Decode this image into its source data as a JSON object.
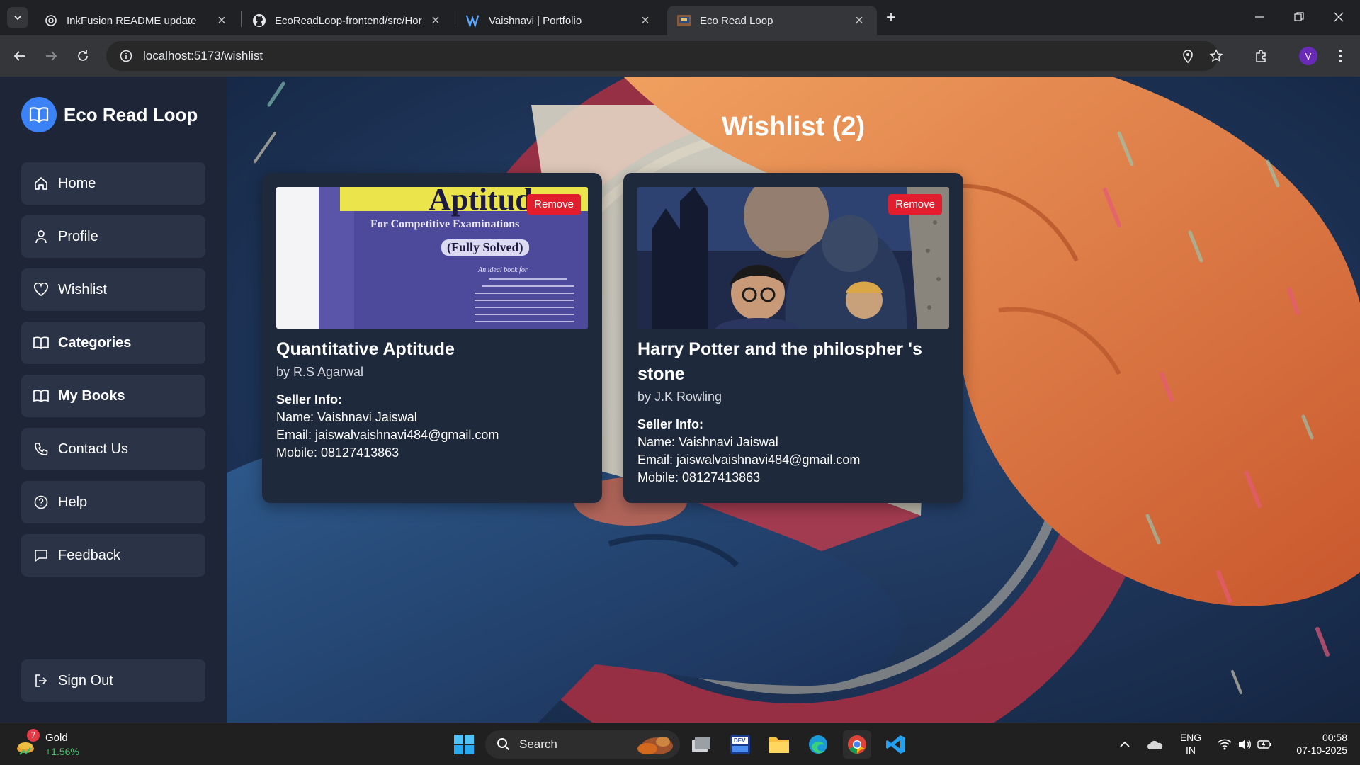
{
  "browser": {
    "tabs": [
      {
        "title": "InkFusion README update",
        "active": false
      },
      {
        "title": "EcoReadLoop-frontend/src/Hor",
        "active": false
      },
      {
        "title": "Vaishnavi | Portfolio",
        "active": false
      },
      {
        "title": "Eco Read Loop",
        "active": true
      }
    ],
    "url": "localhost:5173/wishlist",
    "profile_initial": "V"
  },
  "app": {
    "brand": "Eco Read Loop",
    "nav": [
      {
        "label": "Home",
        "icon": "home-icon"
      },
      {
        "label": "Profile",
        "icon": "user-icon"
      },
      {
        "label": "Wishlist",
        "icon": "heart-icon"
      },
      {
        "label": "Categories",
        "icon": "book-open-icon"
      },
      {
        "label": "My Books",
        "icon": "book-open-icon"
      },
      {
        "label": "Contact Us",
        "icon": "phone-icon"
      },
      {
        "label": "Help",
        "icon": "help-circle-icon"
      },
      {
        "label": "Feedback",
        "icon": "message-square-icon"
      }
    ],
    "sign_out": "Sign Out",
    "page_title": "Wishlist (2)",
    "wishlist": [
      {
        "title": "Quantitative Aptitude",
        "author": "by R.S Agarwal",
        "remove_label": "Remove",
        "cover_text": {
          "headline": "Aptitude",
          "line1": "For Competitive Examinations",
          "line2": "(Fully Solved)",
          "line3": "An ideal book for"
        },
        "seller_heading": "Seller Info:",
        "seller_name": "Name: Vaishnavi Jaiswal",
        "seller_email": "Email: jaiswalvaishnavi484@gmail.com",
        "seller_mobile": "Mobile: 08127413863"
      },
      {
        "title": "Harry Potter and the philospher 's stone",
        "author": "by J.K Rowling",
        "remove_label": "Remove",
        "seller_heading": "Seller Info:",
        "seller_name": "Name: Vaishnavi Jaiswal",
        "seller_email": "Email: jaiswalvaishnavi484@gmail.com",
        "seller_mobile": "Mobile: 08127413863"
      }
    ]
  },
  "taskbar": {
    "widget": {
      "title": "Gold",
      "change": "+1.56%",
      "badge": "7"
    },
    "search_placeholder": "Search",
    "lang_top": "ENG",
    "lang_bottom": "IN",
    "time": "00:58",
    "date": "07-10-2025"
  },
  "colors": {
    "sidebar_bg": "#1d2536",
    "nav_item_bg": "#2b3346",
    "card_bg": "#1e293b",
    "accent_blue": "#3b82f6",
    "remove_red": "#e11d2e"
  }
}
